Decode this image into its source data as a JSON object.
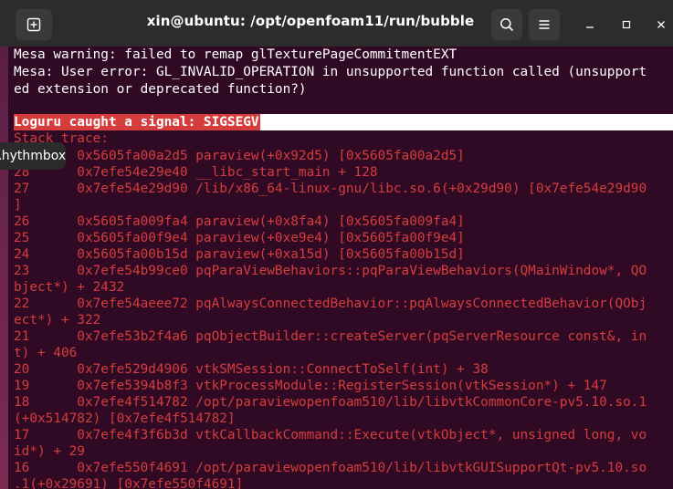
{
  "window": {
    "title": "xin@ubuntu: /opt/openfoam11/run/bubble"
  },
  "icons": {
    "new_tab": "new-tab-icon",
    "search": "search-icon",
    "menu": "hamburger-menu-icon",
    "minimize": "minimize-icon",
    "maximize": "maximize-icon",
    "close": "close-icon"
  },
  "colors": {
    "terminal_bg": "#300a24",
    "error_red": "#d53d3d",
    "titlebar_bg": "#2c2c2c"
  },
  "terminal": {
    "mesa_lines": [
      "Mesa warning: failed to remap glTexturePageCommitmentEXT",
      "Mesa: User error: GL_INVALID_OPERATION in unsupported function called (unsupport",
      "ed extension or deprecated function?)"
    ],
    "signal_line": "Loguru caught a signal: SIGSEGV",
    "trace_lines": [
      "Stack trace:",
      "29      0x5605fa00a2d5 paraview(+0x92d5) [0x5605fa00a2d5]",
      "28      0x7efe54e29e40 __libc_start_main + 128",
      "27      0x7efe54e29d90 /lib/x86_64-linux-gnu/libc.so.6(+0x29d90) [0x7efe54e29d90",
      "]",
      "26      0x5605fa009fa4 paraview(+0x8fa4) [0x5605fa009fa4]",
      "25      0x5605fa00f9e4 paraview(+0xe9e4) [0x5605fa00f9e4]",
      "24      0x5605fa00b15d paraview(+0xa15d) [0x5605fa00b15d]",
      "23      0x7efe54b99ce0 pqParaViewBehaviors::pqParaViewBehaviors(QMainWindow*, QO",
      "bject*) + 2432",
      "22      0x7efe54aeee72 pqAlwaysConnectedBehavior::pqAlwaysConnectedBehavior(QObj",
      "ect*) + 322",
      "21      0x7efe53b2f4a6 pqObjectBuilder::createServer(pqServerResource const&, in",
      "t) + 406",
      "20      0x7efe529d4906 vtkSMSession::ConnectToSelf(int) + 38",
      "19      0x7efe5394b8f3 vtkProcessModule::RegisterSession(vtkSession*) + 147",
      "18      0x7efe4f514782 /opt/paraviewopenfoam510/lib/libvtkCommonCore-pv5.10.so.1",
      "(+0x514782) [0x7efe4f514782]",
      "17      0x7efe4f3f6b3d vtkCallbackCommand::Execute(vtkObject*, unsigned long, vo",
      "id*) + 29",
      "16      0x7efe550f4691 /opt/paraviewopenfoam510/lib/libvtkGUISupportQt-pv5.10.so",
      ".1(+0x29691) [0x7efe550f4691]"
    ]
  },
  "tooltip": {
    "text": "Rhythmbox"
  }
}
